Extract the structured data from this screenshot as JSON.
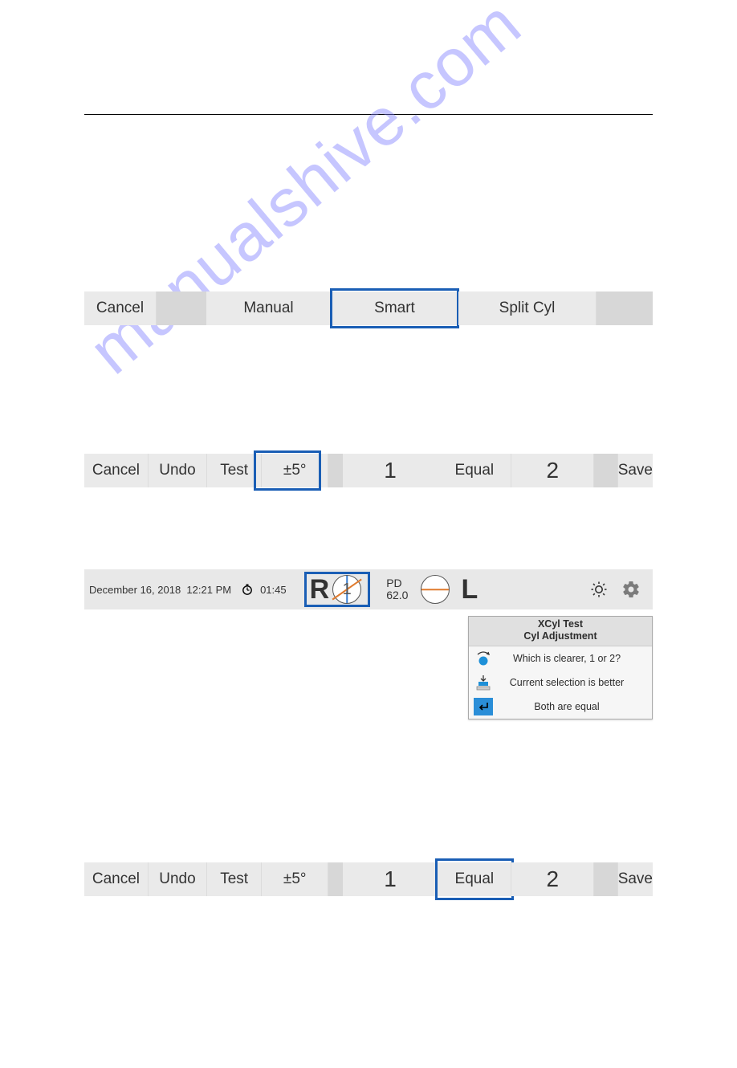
{
  "watermark": "manualshive.com",
  "toolbar1": {
    "cancel": "Cancel",
    "manual": "Manual",
    "smart": "Smart",
    "split_cyl": "Split Cyl"
  },
  "actions": {
    "cancel": "Cancel",
    "undo": "Undo",
    "test": "Test",
    "degree": "±5°",
    "one": "1",
    "equal": "Equal",
    "two": "2",
    "save": "Save"
  },
  "status": {
    "date": "December 16, 2018",
    "time": "12:21 PM",
    "elapsed": "01:45",
    "r_letter": "R",
    "r_num": "1",
    "pd_label": "PD",
    "pd_value": "62.0",
    "l_letter": "L"
  },
  "guide": {
    "title1": "XCyl Test",
    "title2": "Cyl Adjustment",
    "row1": "Which is clearer, 1 or 2?",
    "row2": "Current selection is better",
    "row3": "Both are equal"
  }
}
